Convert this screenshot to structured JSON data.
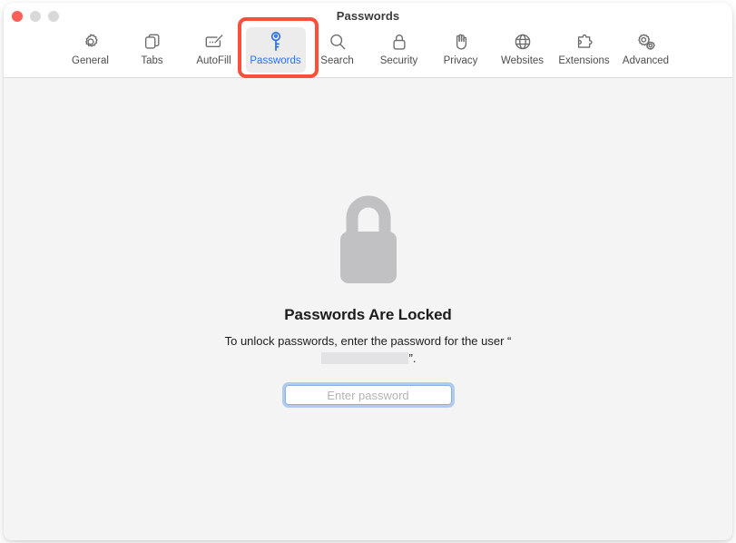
{
  "window": {
    "title": "Passwords",
    "traffic_lights": [
      {
        "name": "close",
        "color": "#fc5f57"
      },
      {
        "name": "minimize",
        "color": "#d9d9d9"
      },
      {
        "name": "maximize",
        "color": "#d9d9d9"
      }
    ]
  },
  "toolbar": {
    "tabs": [
      {
        "label": "General",
        "icon": "gear-icon",
        "selected": false
      },
      {
        "label": "Tabs",
        "icon": "tabs-icon",
        "selected": false
      },
      {
        "label": "AutoFill",
        "icon": "autofill-icon",
        "selected": false
      },
      {
        "label": "Passwords",
        "icon": "key-icon",
        "selected": true
      },
      {
        "label": "Search",
        "icon": "magnifier-icon",
        "selected": false
      },
      {
        "label": "Security",
        "icon": "lock-icon",
        "selected": false
      },
      {
        "label": "Privacy",
        "icon": "hand-icon",
        "selected": false
      },
      {
        "label": "Websites",
        "icon": "globe-icon",
        "selected": false
      },
      {
        "label": "Extensions",
        "icon": "puzzle-icon",
        "selected": false
      },
      {
        "label": "Advanced",
        "icon": "gears-icon",
        "selected": false
      }
    ],
    "selected_tab": "Passwords",
    "selected_accent_color": "#2b72e8"
  },
  "annotation": {
    "shape": "rectangle",
    "target": "Passwords",
    "color": "#fb4e3d"
  },
  "main": {
    "lock_icon": "padlock-icon",
    "headline": "Passwords Are Locked",
    "subtext_before": "To unlock passwords, enter the password for the user “",
    "subtext_after": "”.",
    "redacted_username": "",
    "password_field": {
      "placeholder": "Enter password",
      "value": "",
      "focused": true
    }
  }
}
